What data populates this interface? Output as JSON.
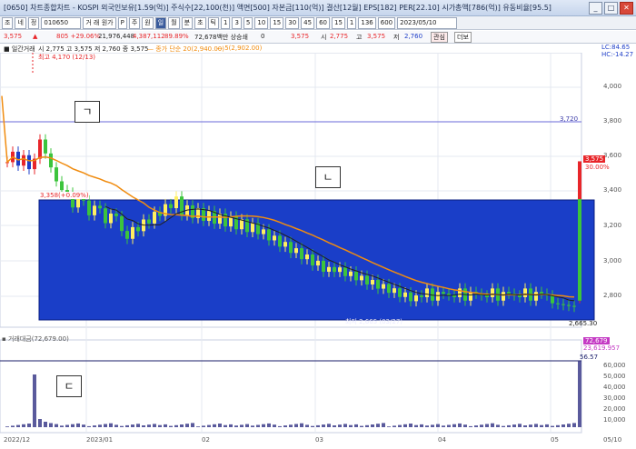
{
  "window": {
    "title": "[0650] 차트종합차트 - KOSPI 외국인보유[1.59(억)] 주식수[22,100(천)] 액면[500] 자본금[110(억)] 결산[12월] EPS[182] PER[22.10] 시가총액[786(억)] 유동비율[95.5]",
    "buttons": [
      "_",
      "□",
      "✕"
    ]
  },
  "toolbar": {
    "items": [
      "조",
      "네",
      "정",
      "010650",
      "거 래 원가",
      "P",
      "주",
      "원",
      "일",
      "월",
      "분",
      "초",
      "틱",
      "1",
      "3",
      "5",
      "10",
      "15",
      "30",
      "45",
      "60",
      "15",
      "1",
      "136",
      "600",
      "2023/05/10"
    ],
    "code": "010650",
    "name_label": "거래원가",
    "date": "2023/05/10",
    "selected": "일"
  },
  "quote": {
    "price": "3,575",
    "arrow": "▲",
    "change": "805 +29.06%",
    "volume": "21,976,448",
    "amount": "4,387,112",
    "rate": "89.89%",
    "extra": "72,678백만 상승쇄",
    "zero": "0",
    "price2": "3,575",
    "open_label": "시",
    "open": "2,775",
    "high_label": "고",
    "high": "3,575",
    "low_label": "저",
    "low": "2,760",
    "btn_fav": "관심",
    "btn_more": "더보"
  },
  "legend": {
    "price_label": "■ 일간거래",
    "price_values": "시 2,775 고 3,575 저 2,760 종 3,575",
    "ma_label": "— 종가 단순 20(2,940.00)",
    "ma2": "— 5(2,902.00)"
  },
  "annotations": {
    "label_a": "ㄱ",
    "label_b": "ㄴ",
    "label_c": "ㄷ",
    "high_marker": "최고 4,170 (12/13)",
    "low_marker": "최저 2,665 (03/27)",
    "mid_marker": "3,358(+0.09%)",
    "ref_line": "3,720",
    "box_right_label": "2,665.30"
  },
  "right_axis": {
    "top_labels": [
      "LC:84.65",
      "HC:-14.27"
    ],
    "price_ticks": [
      "4,000",
      "3,800",
      "3,600",
      "3,400",
      "3,200",
      "3,000",
      "2,800"
    ],
    "current_price": "3,575",
    "current_change": "30.00%",
    "volume_ticks": [
      "60,000",
      "50,000",
      "40,000",
      "30,000",
      "20,000",
      "10,000"
    ],
    "volume_current": "72,679",
    "volume_extra": "23,619.957",
    "volume_ref": "56.57"
  },
  "volume_panel": {
    "label": "▪ 거래대금(72,679.00)"
  },
  "x_axis": {
    "labels": [
      "2022/12",
      "2023/01",
      "02",
      "03",
      "04",
      "05",
      "05/10"
    ]
  },
  "colors": {
    "up": "#e8262a",
    "down": "#1e3ec8",
    "box": "#1a3ec8",
    "ma20": "#f08c10",
    "ma5": "#202020",
    "volume": "#5a5a9c"
  },
  "chart_data": {
    "type": "candlestick",
    "box_range": [
      2665,
      3358
    ],
    "highlight_candles": [
      {
        "x": "05/10",
        "open": 2775,
        "high": 3575,
        "low": 2760,
        "close": 3575
      }
    ],
    "volume_spikes": [
      {
        "x": "2022/12",
        "value": 58000
      },
      {
        "x": "05/10",
        "value": 72679
      }
    ]
  }
}
